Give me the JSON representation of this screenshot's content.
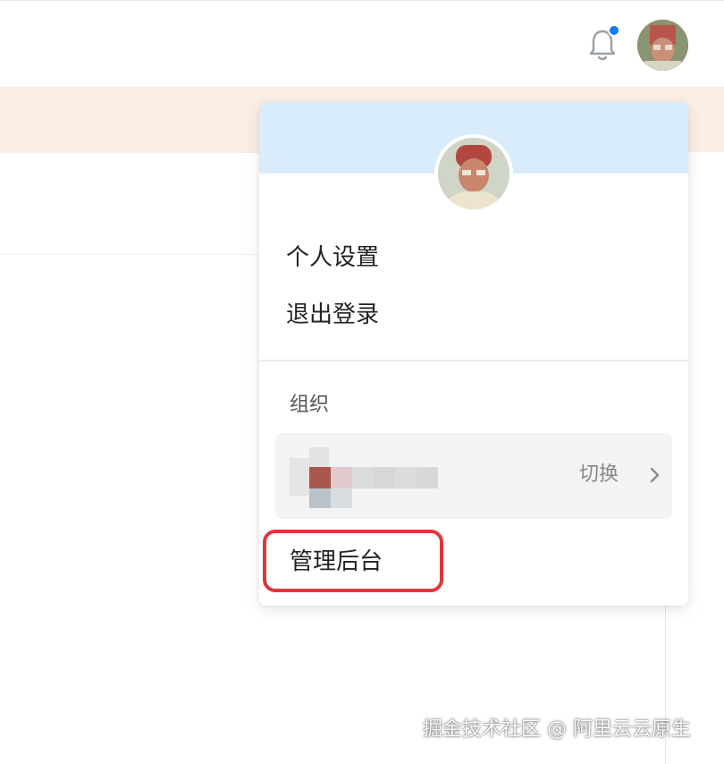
{
  "header": {
    "notifications": {
      "icon": "bell-icon",
      "has_unread": true,
      "dot_color": "#1677ff"
    },
    "user_avatar": {
      "icon": "user-avatar"
    }
  },
  "banner": {
    "background": "#fdeee4"
  },
  "user_menu": {
    "header_color": "#d8ecfb",
    "items": [
      {
        "label": "个人设置"
      },
      {
        "label": "退出登录"
      }
    ],
    "organization": {
      "section_label": "组织",
      "org_name": "",
      "switch_label": "切换",
      "switch_icon": "chevron-right-icon"
    },
    "admin": {
      "label": "管理后台",
      "highlight_color": "#e0353b"
    }
  },
  "watermark": "掘金技术社区 @ 阿里云云原生"
}
